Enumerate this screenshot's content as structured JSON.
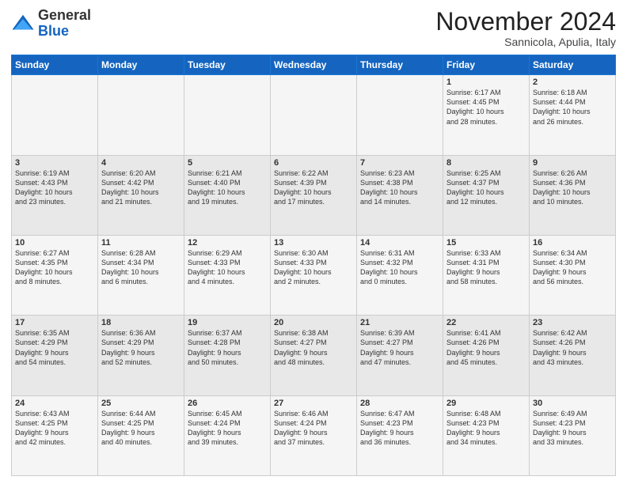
{
  "header": {
    "logo_general": "General",
    "logo_blue": "Blue",
    "month_title": "November 2024",
    "location": "Sannicola, Apulia, Italy"
  },
  "days_of_week": [
    "Sunday",
    "Monday",
    "Tuesday",
    "Wednesday",
    "Thursday",
    "Friday",
    "Saturday"
  ],
  "weeks": [
    {
      "days": [
        {
          "num": "",
          "info": ""
        },
        {
          "num": "",
          "info": ""
        },
        {
          "num": "",
          "info": ""
        },
        {
          "num": "",
          "info": ""
        },
        {
          "num": "",
          "info": ""
        },
        {
          "num": "1",
          "info": "Sunrise: 6:17 AM\nSunset: 4:45 PM\nDaylight: 10 hours\nand 28 minutes."
        },
        {
          "num": "2",
          "info": "Sunrise: 6:18 AM\nSunset: 4:44 PM\nDaylight: 10 hours\nand 26 minutes."
        }
      ]
    },
    {
      "days": [
        {
          "num": "3",
          "info": "Sunrise: 6:19 AM\nSunset: 4:43 PM\nDaylight: 10 hours\nand 23 minutes."
        },
        {
          "num": "4",
          "info": "Sunrise: 6:20 AM\nSunset: 4:42 PM\nDaylight: 10 hours\nand 21 minutes."
        },
        {
          "num": "5",
          "info": "Sunrise: 6:21 AM\nSunset: 4:40 PM\nDaylight: 10 hours\nand 19 minutes."
        },
        {
          "num": "6",
          "info": "Sunrise: 6:22 AM\nSunset: 4:39 PM\nDaylight: 10 hours\nand 17 minutes."
        },
        {
          "num": "7",
          "info": "Sunrise: 6:23 AM\nSunset: 4:38 PM\nDaylight: 10 hours\nand 14 minutes."
        },
        {
          "num": "8",
          "info": "Sunrise: 6:25 AM\nSunset: 4:37 PM\nDaylight: 10 hours\nand 12 minutes."
        },
        {
          "num": "9",
          "info": "Sunrise: 6:26 AM\nSunset: 4:36 PM\nDaylight: 10 hours\nand 10 minutes."
        }
      ]
    },
    {
      "days": [
        {
          "num": "10",
          "info": "Sunrise: 6:27 AM\nSunset: 4:35 PM\nDaylight: 10 hours\nand 8 minutes."
        },
        {
          "num": "11",
          "info": "Sunrise: 6:28 AM\nSunset: 4:34 PM\nDaylight: 10 hours\nand 6 minutes."
        },
        {
          "num": "12",
          "info": "Sunrise: 6:29 AM\nSunset: 4:33 PM\nDaylight: 10 hours\nand 4 minutes."
        },
        {
          "num": "13",
          "info": "Sunrise: 6:30 AM\nSunset: 4:33 PM\nDaylight: 10 hours\nand 2 minutes."
        },
        {
          "num": "14",
          "info": "Sunrise: 6:31 AM\nSunset: 4:32 PM\nDaylight: 10 hours\nand 0 minutes."
        },
        {
          "num": "15",
          "info": "Sunrise: 6:33 AM\nSunset: 4:31 PM\nDaylight: 9 hours\nand 58 minutes."
        },
        {
          "num": "16",
          "info": "Sunrise: 6:34 AM\nSunset: 4:30 PM\nDaylight: 9 hours\nand 56 minutes."
        }
      ]
    },
    {
      "days": [
        {
          "num": "17",
          "info": "Sunrise: 6:35 AM\nSunset: 4:29 PM\nDaylight: 9 hours\nand 54 minutes."
        },
        {
          "num": "18",
          "info": "Sunrise: 6:36 AM\nSunset: 4:29 PM\nDaylight: 9 hours\nand 52 minutes."
        },
        {
          "num": "19",
          "info": "Sunrise: 6:37 AM\nSunset: 4:28 PM\nDaylight: 9 hours\nand 50 minutes."
        },
        {
          "num": "20",
          "info": "Sunrise: 6:38 AM\nSunset: 4:27 PM\nDaylight: 9 hours\nand 48 minutes."
        },
        {
          "num": "21",
          "info": "Sunrise: 6:39 AM\nSunset: 4:27 PM\nDaylight: 9 hours\nand 47 minutes."
        },
        {
          "num": "22",
          "info": "Sunrise: 6:41 AM\nSunset: 4:26 PM\nDaylight: 9 hours\nand 45 minutes."
        },
        {
          "num": "23",
          "info": "Sunrise: 6:42 AM\nSunset: 4:26 PM\nDaylight: 9 hours\nand 43 minutes."
        }
      ]
    },
    {
      "days": [
        {
          "num": "24",
          "info": "Sunrise: 6:43 AM\nSunset: 4:25 PM\nDaylight: 9 hours\nand 42 minutes."
        },
        {
          "num": "25",
          "info": "Sunrise: 6:44 AM\nSunset: 4:25 PM\nDaylight: 9 hours\nand 40 minutes."
        },
        {
          "num": "26",
          "info": "Sunrise: 6:45 AM\nSunset: 4:24 PM\nDaylight: 9 hours\nand 39 minutes."
        },
        {
          "num": "27",
          "info": "Sunrise: 6:46 AM\nSunset: 4:24 PM\nDaylight: 9 hours\nand 37 minutes."
        },
        {
          "num": "28",
          "info": "Sunrise: 6:47 AM\nSunset: 4:23 PM\nDaylight: 9 hours\nand 36 minutes."
        },
        {
          "num": "29",
          "info": "Sunrise: 6:48 AM\nSunset: 4:23 PM\nDaylight: 9 hours\nand 34 minutes."
        },
        {
          "num": "30",
          "info": "Sunrise: 6:49 AM\nSunset: 4:23 PM\nDaylight: 9 hours\nand 33 minutes."
        }
      ]
    }
  ]
}
